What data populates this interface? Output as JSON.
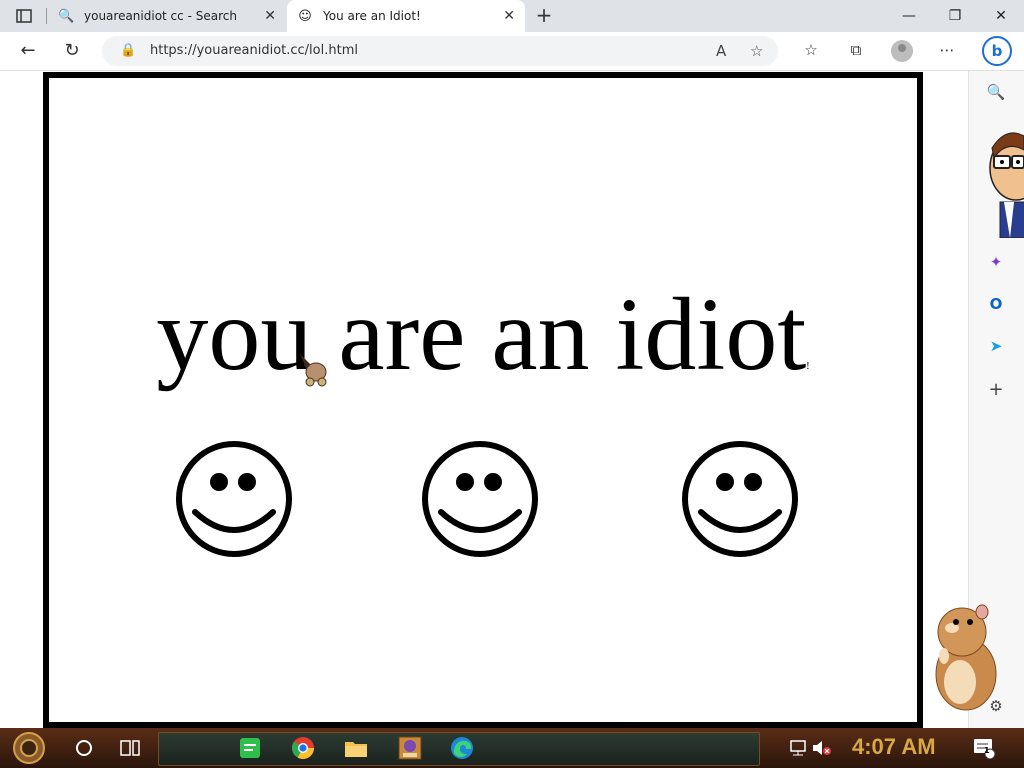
{
  "browser": {
    "tabs": [
      {
        "title": "youareanidiot cc - Search",
        "active": false,
        "icon": "search-icon"
      },
      {
        "title": "You are an Idiot!",
        "active": true,
        "icon": "smiley-icon"
      }
    ],
    "address_url": "https://youareanidiot.cc/lol.html"
  },
  "page": {
    "headline": "you are an idiot",
    "headline_mark": "!",
    "smiley_count": 3
  },
  "taskbar": {
    "clock": "4:07 AM",
    "notification_count": "1",
    "pinned_icons": [
      "cortana-icon",
      "task-view-icon",
      "notes-icon",
      "chrome-icon",
      "file-explorer-icon",
      "bonzi-app-icon",
      "edge-icon"
    ]
  },
  "colors": {
    "tab_strip": "#dfe3e8",
    "page_border": "#000000",
    "taskbar": "#3a1d0e",
    "clock": "#d7a843"
  }
}
